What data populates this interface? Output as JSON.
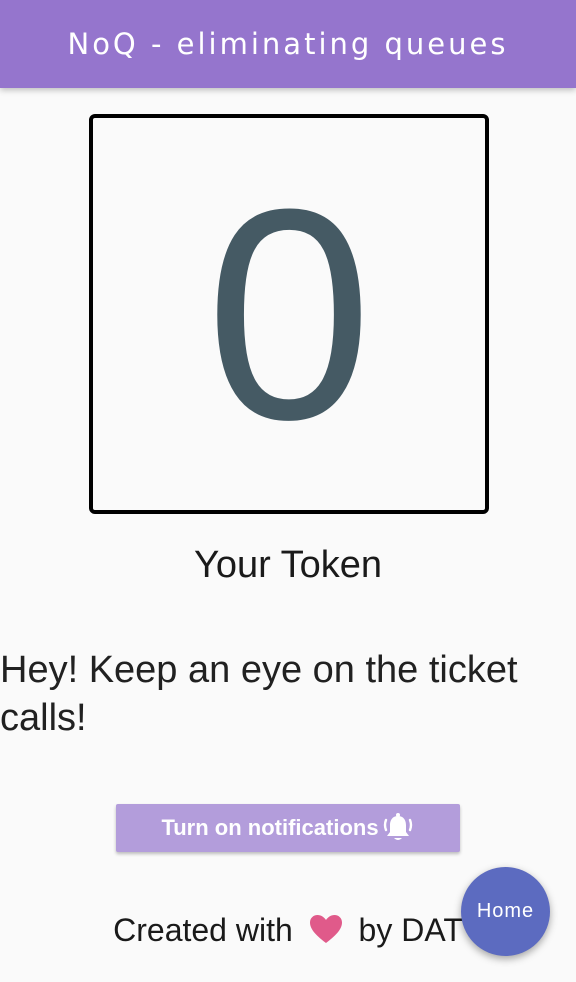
{
  "app_bar": {
    "title": "NoQ - eliminating queues",
    "color": "#9575cd"
  },
  "token": {
    "number": "0",
    "label": "Your Token",
    "number_color": "#455a64"
  },
  "message": "Hey! Keep an eye on the ticket calls!",
  "notify_button": {
    "label": "Turn on notifications",
    "icon": "bell-ringing-icon",
    "color": "#b39ddb"
  },
  "footer": {
    "prefix": "Created with",
    "icon": "heart-icon",
    "suffix": "by DAT",
    "heart_color": "#e05a8a"
  },
  "fab": {
    "label": "Home",
    "color": "#5c6bc0"
  }
}
